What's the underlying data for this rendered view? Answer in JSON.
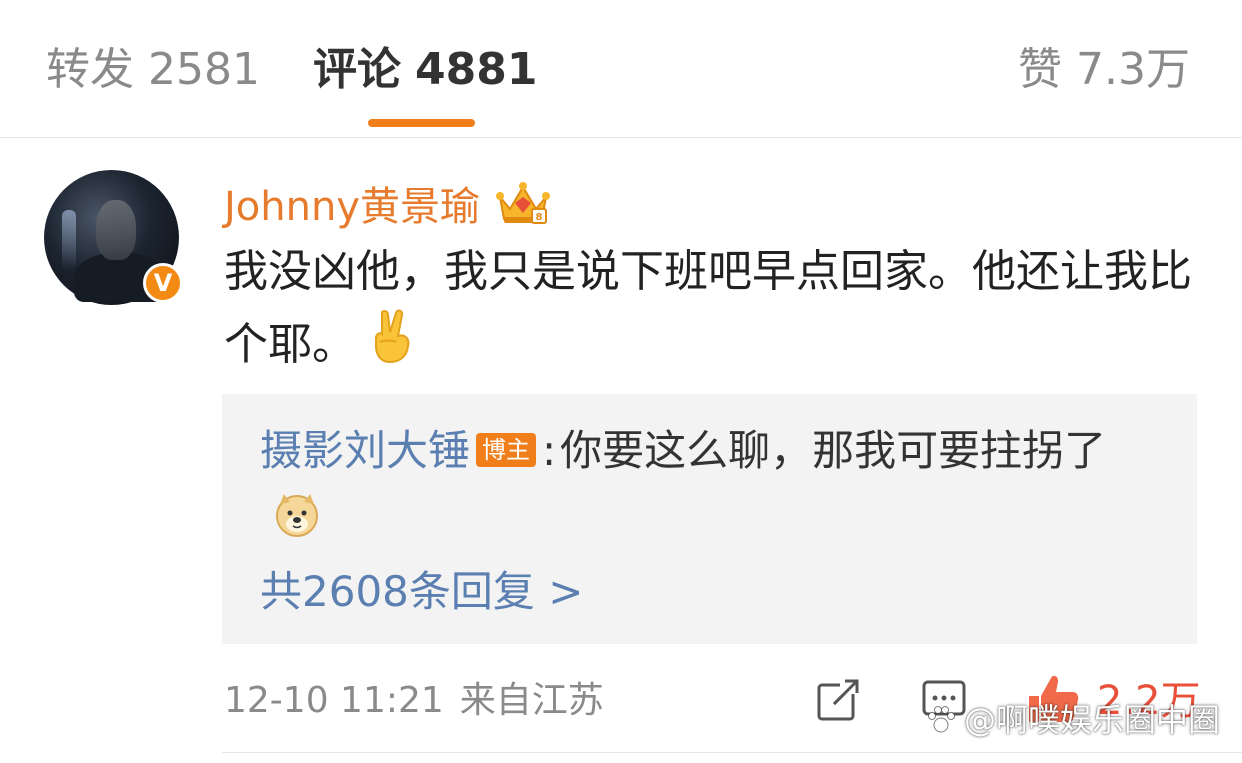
{
  "tabs": {
    "repost": {
      "label": "转发",
      "count": "2581"
    },
    "comments": {
      "label": "评论",
      "count": "4881"
    },
    "likes": {
      "label": "赞",
      "count": "7.3万"
    },
    "active": "comments",
    "accent_color": "#f07e1a"
  },
  "comment": {
    "username": "Johnny黄景瑜",
    "username_color": "#e77b2d",
    "user_badge_icon": "crown-icon",
    "verified_badge": "V",
    "text": "我没凶他，我只是说下班吧早点回家。他还让我比个耶。",
    "emoji": "✌️",
    "time": "12-10 11:21",
    "location": "来自江苏",
    "like_count": "2.2万"
  },
  "reply": {
    "author": "摄影刘大锤",
    "author_tag": "博主",
    "colon": ":",
    "text": "你要这么聊，那我可要拄拐了",
    "emoji_icon": "doge-icon",
    "more_label": "共2608条回复 >"
  },
  "watermark": {
    "text": "@啊噗娱乐圈中圈"
  }
}
